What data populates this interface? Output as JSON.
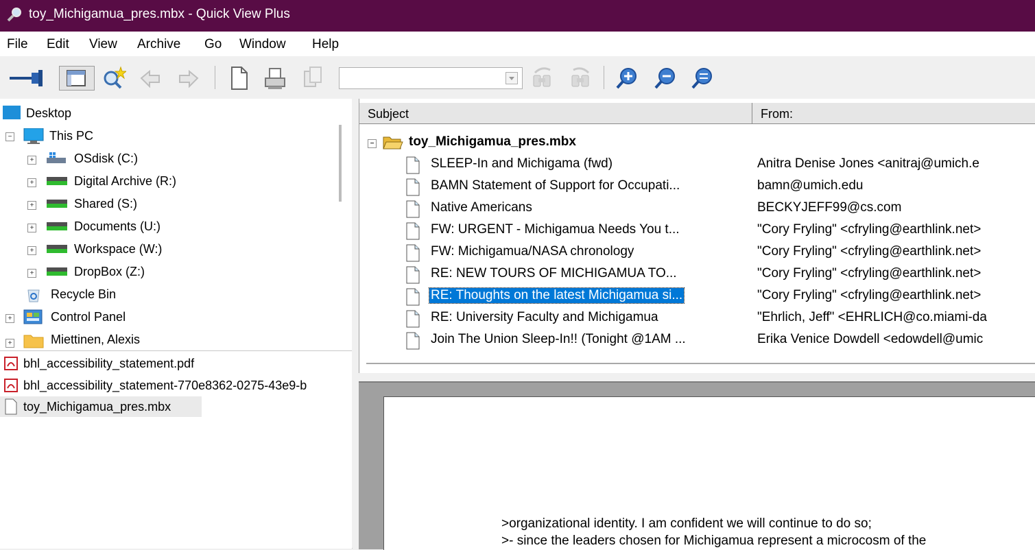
{
  "window": {
    "title": "toy_Michigamua_pres.mbx - Quick View Plus",
    "icon": "magnifier-icon"
  },
  "menu": [
    "File",
    "Edit",
    "View",
    "Archive",
    "Go",
    "Window",
    "Help"
  ],
  "toolbar": {
    "buttons": [
      "pin-icon",
      "view-panel-icon",
      "find-star-icon",
      "back-icon",
      "forward-icon",
      "new-page-icon",
      "print-icon",
      "copy-icon",
      "search-prev-icon",
      "search-next-icon",
      "zoom-in-icon",
      "zoom-out-icon",
      "zoom-fit-icon"
    ],
    "search_value": ""
  },
  "tree": {
    "desktop": "Desktop",
    "this_pc": "This PC",
    "drives": [
      "OSdisk (C:)",
      "Digital Archive (R:)",
      "Shared (S:)",
      "Documents (U:)",
      "Workspace (W:)",
      "DropBox (Z:)"
    ],
    "recycle_bin": "Recycle Bin",
    "control_panel": "Control Panel",
    "user_folder": "Miettinen, Alexis"
  },
  "files": [
    "bhl_accessibility_statement.pdf",
    "bhl_accessibility_statement-770e8362-0275-43e9-b",
    "toy_Michigamua_pres.mbx"
  ],
  "message_list": {
    "col_subject": "Subject",
    "col_from": "From:",
    "root": "toy_Michigamua_pres.mbx",
    "rows": [
      {
        "subject": "SLEEP-In and Michigama (fwd)",
        "from": "Anitra Denise Jones <anitraj@umich.e"
      },
      {
        "subject": "BAMN Statement of Support for Occupati...",
        "from": "bamn@umich.edu"
      },
      {
        "subject": "Native Americans",
        "from": "BECKYJEFF99@cs.com"
      },
      {
        "subject": "FW: URGENT - Michigamua Needs You t...",
        "from": "\"Cory Fryling\" <cfryling@earthlink.net>"
      },
      {
        "subject": "FW: Michigamua/NASA chronology",
        "from": "\"Cory Fryling\" <cfryling@earthlink.net>"
      },
      {
        "subject": "RE: NEW TOURS OF MICHIGAMUA TO...",
        "from": "\"Cory Fryling\" <cfryling@earthlink.net>"
      },
      {
        "subject": "RE: Thoughts on the latest Michigamua si...",
        "from": "\"Cory Fryling\" <cfryling@earthlink.net>"
      },
      {
        "subject": "RE: University Faculty and Michigamua",
        "from": "\"Ehrlich, Jeff\" <EHRLICH@co.miami-da"
      },
      {
        "subject": "Join The Union Sleep-In!! (Tonight @1AM ...",
        "from": "Erika Venice Dowdell <edowdell@umic"
      }
    ]
  },
  "preview": {
    "lines": [
      ">organizational identity.  I am confident we will continue to do so;",
      ">- since the leaders chosen for Michigamua represent a microcosm of the"
    ]
  },
  "colors": {
    "title_bar": "#580c45",
    "selection": "#0078d7"
  }
}
